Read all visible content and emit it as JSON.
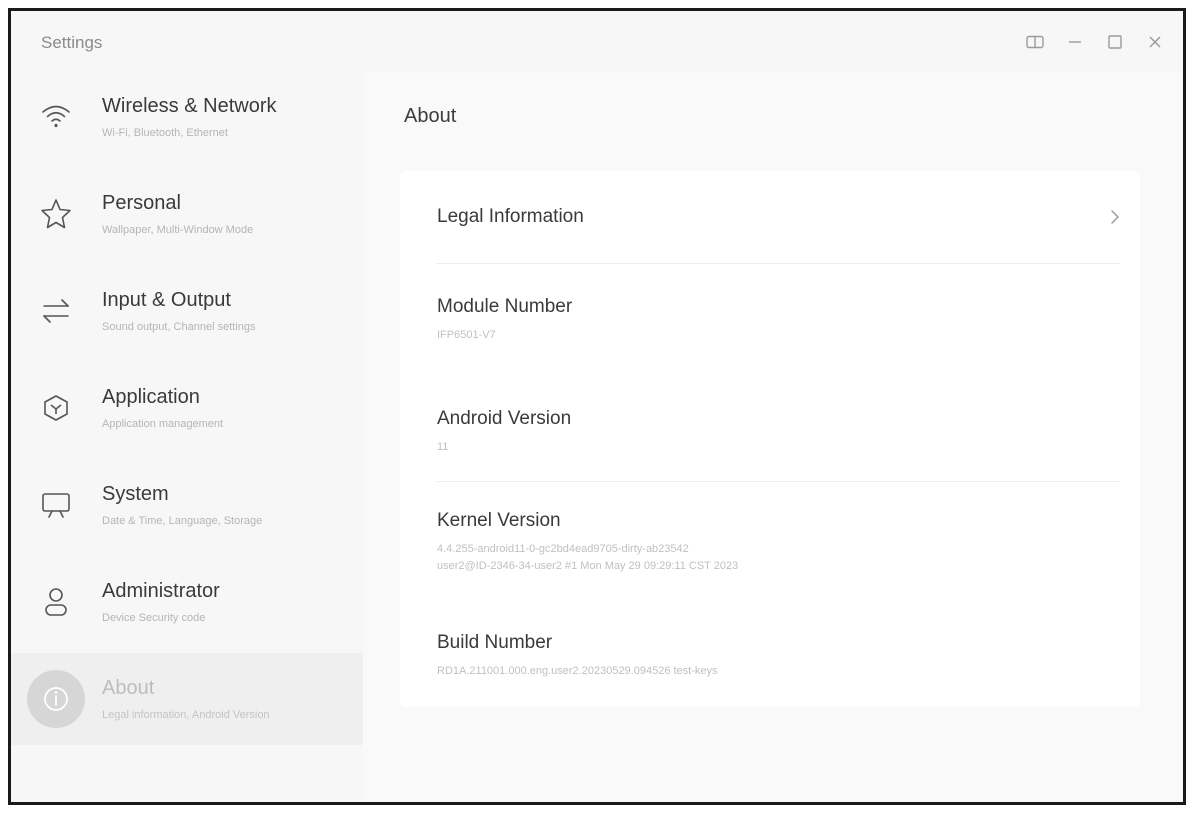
{
  "window": {
    "title": "Settings"
  },
  "sidebar": {
    "items": [
      {
        "label": "Wireless & Network",
        "subtitle": "Wi-Fi, Bluetooth, Ethernet",
        "icon": "wifi-icon"
      },
      {
        "label": "Personal",
        "subtitle": "Wallpaper, Multi-Window Mode",
        "icon": "star-icon"
      },
      {
        "label": "Input & Output",
        "subtitle": "Sound output, Channel settings",
        "icon": "swap-arrows-icon"
      },
      {
        "label": "Application",
        "subtitle": "Application management",
        "icon": "app-cube-icon"
      },
      {
        "label": "System",
        "subtitle": "Date & Time, Language, Storage",
        "icon": "monitor-icon"
      },
      {
        "label": "Administrator",
        "subtitle": "Device Security code",
        "icon": "user-icon"
      },
      {
        "label": "About",
        "subtitle": "Legal information, Android Version",
        "icon": "info-icon",
        "active": true
      }
    ]
  },
  "main": {
    "title": "About",
    "rows": [
      {
        "title": "Legal Information",
        "has_chevron": true
      },
      {
        "title": "Module Number",
        "value": "IFP6501-V7"
      },
      {
        "title": "Android Version",
        "value": "11"
      },
      {
        "title": "Kernel Version",
        "value_lines": [
          "4.4.255-android11-0-gc2bd4ead9705-dirty-ab23542",
          "user2@ID-2346-34-user2 #1 Mon May 29 09:29:11 CST 2023"
        ]
      },
      {
        "title": "Build Number",
        "value": "RD1A.211001.000.eng.user2.20230529.094526 test-keys"
      }
    ]
  },
  "colors": {
    "background": "#f7f7f7",
    "card": "#ffffff",
    "active_item": "#efefef",
    "text_primary": "#3a3a3a",
    "text_secondary": "#b5b5b5"
  }
}
